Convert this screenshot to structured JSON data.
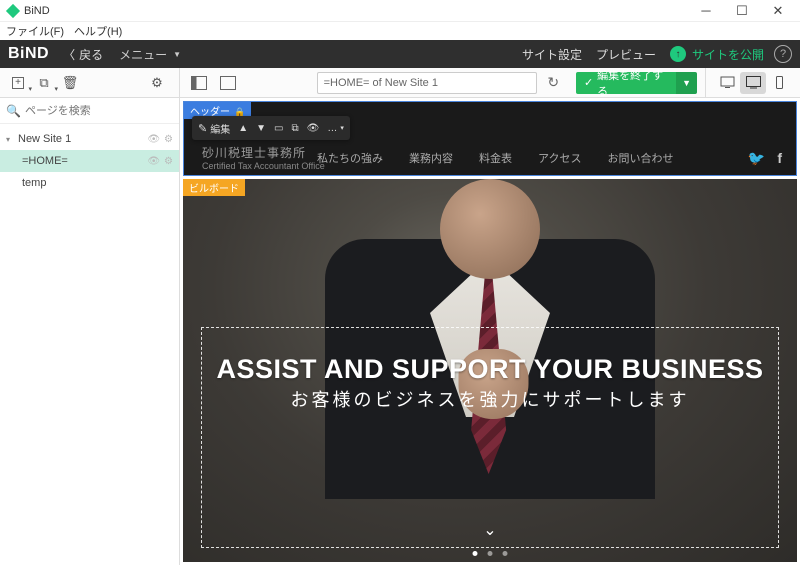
{
  "titlebar": {
    "app": "BiND"
  },
  "menubar": {
    "file": "ファイル(F)",
    "help": "ヘルプ(H)"
  },
  "topbar": {
    "logo": "BiND",
    "back": "戻る",
    "menu": "メニュー",
    "site_settings": "サイト設定",
    "preview": "プレビュー",
    "publish": "サイトを公開"
  },
  "toolbar2": {
    "url": "=HOME= of New Site 1",
    "end_edit": "編集を終了する"
  },
  "sidebar": {
    "search_placeholder": "ページを検索",
    "tree": [
      {
        "label": "New Site 1",
        "caret": "▾",
        "selected": false,
        "indent": 0,
        "has_settings": true
      },
      {
        "label": "=HOME=",
        "selected": true,
        "indent": 1,
        "has_settings": true
      },
      {
        "label": "temp",
        "selected": false,
        "indent": 1
      }
    ]
  },
  "header_block": {
    "label": "ヘッダー",
    "edit": "編集",
    "logo_main": "砂川税理士事務所",
    "logo_sub": "Certified Tax Accountant Office",
    "nav": [
      "私たちの強み",
      "業務内容",
      "料金表",
      "アクセス",
      "お問い合わせ"
    ]
  },
  "billboard": {
    "label": "ビルボード",
    "h1": "ASSIST AND SUPPORT YOUR BUSINESS",
    "h2": "お客様のビジネスを強力にサポートします"
  }
}
